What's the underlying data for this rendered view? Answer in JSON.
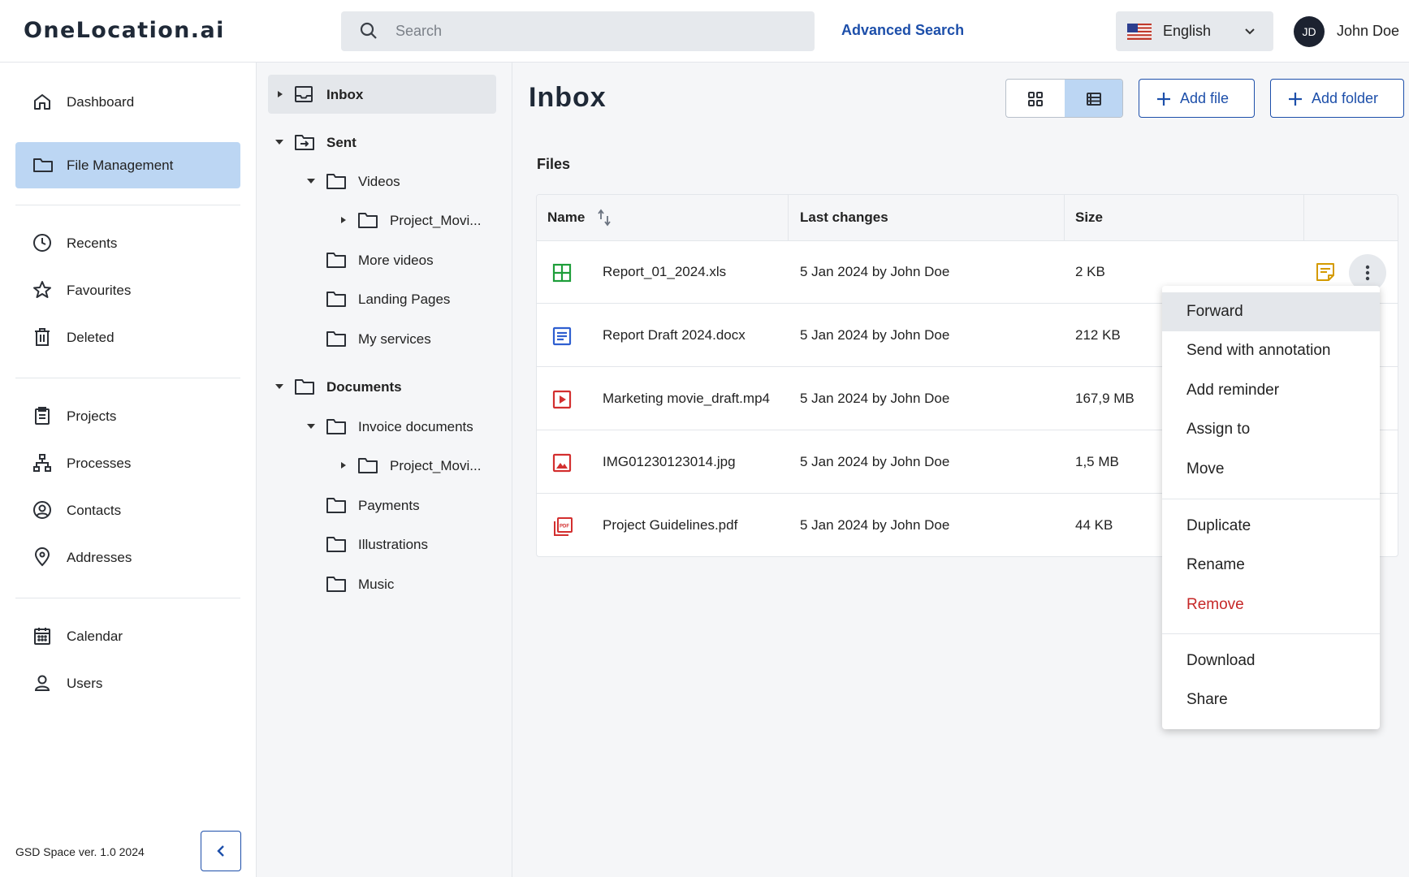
{
  "header": {
    "logo": "OneLocation.ai",
    "search_placeholder": "Search",
    "advanced_search": "Advanced Search",
    "language": "English",
    "user_initials": "JD",
    "user_name": "John Doe"
  },
  "sidebar": {
    "items": [
      {
        "label": "Dashboard",
        "icon": "home-icon"
      },
      {
        "label": "File Management",
        "icon": "folder-icon",
        "active": true
      },
      {
        "label": "Recents",
        "icon": "clock-icon"
      },
      {
        "label": "Favourites",
        "icon": "star-icon"
      },
      {
        "label": "Deleted",
        "icon": "trash-icon"
      },
      {
        "label": "Projects",
        "icon": "clipboard-icon"
      },
      {
        "label": "Processes",
        "icon": "hierarchy-icon"
      },
      {
        "label": "Contacts",
        "icon": "user-circle-icon"
      },
      {
        "label": "Addresses",
        "icon": "location-pin-icon"
      },
      {
        "label": "Calendar",
        "icon": "calendar-icon"
      },
      {
        "label": "Users",
        "icon": "user-icon"
      }
    ],
    "version": "GSD Space ver. 1.0 2024"
  },
  "tree": {
    "nodes": [
      {
        "label": "Inbox",
        "icon": "inbox-icon"
      },
      {
        "label": "Sent",
        "icon": "sent-icon"
      },
      {
        "label": "Videos",
        "icon": "folder-icon"
      },
      {
        "label": "Project_Movi...",
        "icon": "folder-icon"
      },
      {
        "label": "More videos",
        "icon": "folder-icon"
      },
      {
        "label": "Landing Pages",
        "icon": "folder-icon"
      },
      {
        "label": "My services",
        "icon": "folder-icon"
      },
      {
        "label": "Documents",
        "icon": "folder-icon"
      },
      {
        "label": "Invoice documents",
        "icon": "folder-icon"
      },
      {
        "label": "Project_Movi...",
        "icon": "folder-icon"
      },
      {
        "label": "Payments",
        "icon": "folder-icon"
      },
      {
        "label": "Illustrations",
        "icon": "folder-icon"
      },
      {
        "label": "Music",
        "icon": "folder-icon"
      }
    ]
  },
  "main": {
    "title": "Inbox",
    "add_file": "Add file",
    "add_folder": "Add folder",
    "section": "Files",
    "columns": {
      "name": "Name",
      "last_changes": "Last changes",
      "size": "Size"
    },
    "rows": [
      {
        "name": "Report_01_2024.xls",
        "changed": "5 Jan 2024 by John Doe",
        "size": "2 KB",
        "icon": "spreadsheet-icon",
        "color": "#1e9e3a"
      },
      {
        "name": "Report Draft 2024.docx",
        "changed": "5 Jan 2024 by John Doe",
        "size": "212 KB",
        "icon": "document-icon",
        "color": "#2f5fd0"
      },
      {
        "name": "Marketing movie_draft.mp4",
        "changed": "5 Jan 2024 by John Doe",
        "size": "167,9 MB",
        "icon": "video-icon",
        "color": "#d32f2f"
      },
      {
        "name": "IMG01230123014.jpg",
        "changed": "5 Jan 2024 by John Doe",
        "size": "1,5 MB",
        "icon": "image-icon",
        "color": "#d32f2f"
      },
      {
        "name": "Project Guidelines.pdf",
        "changed": "5 Jan 2024 by John Doe",
        "size": "44 KB",
        "icon": "pdf-icon",
        "color": "#d32f2f"
      }
    ]
  },
  "context_menu": {
    "items": [
      "Forward",
      "Send with annotation",
      "Add reminder",
      "Assign to",
      "Move",
      "Duplicate",
      "Rename",
      "Remove",
      "Download",
      "Share"
    ]
  },
  "colors": {
    "accent": "#1d4faa",
    "active_bg": "#bcd6f3",
    "danger": "#c62828",
    "note": "#d49a00"
  }
}
